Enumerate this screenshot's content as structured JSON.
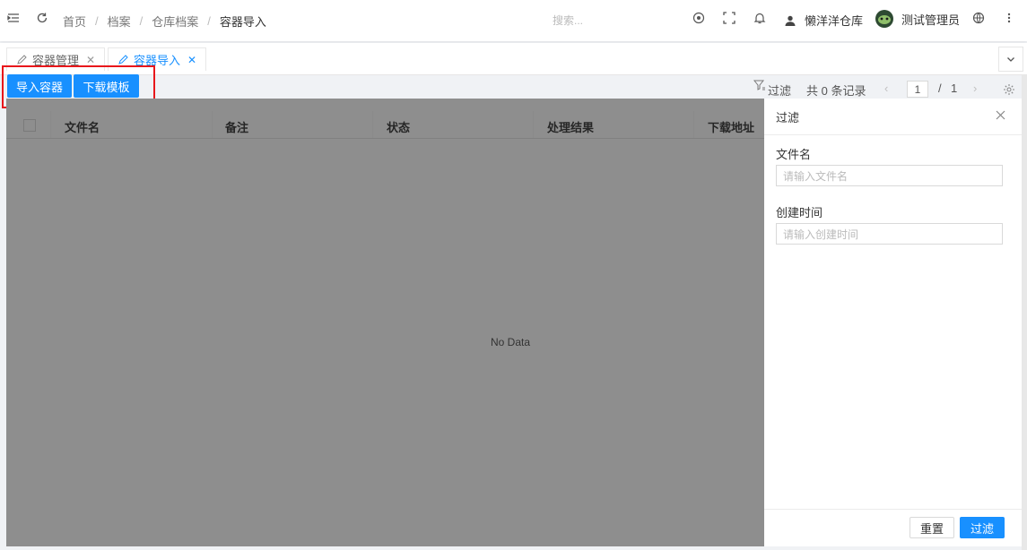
{
  "breadcrumb": [
    "首页",
    "档案",
    "仓库档案",
    "容器导入"
  ],
  "search": {
    "placeholder": "搜索..."
  },
  "header": {
    "warehouse": "懒洋洋仓库",
    "username": "测试管理员"
  },
  "tabs": [
    {
      "label": "容器管理",
      "active": false
    },
    {
      "label": "容器导入",
      "active": true
    }
  ],
  "toolbar": {
    "import_label": "导入容器",
    "download_label": "下载模板",
    "filter_label": "过滤",
    "record_count": "共 0 条记录",
    "page_current": "1",
    "page_sep": "/",
    "page_total": "1"
  },
  "table": {
    "columns": [
      "文件名",
      "备注",
      "状态",
      "处理结果",
      "下载地址"
    ],
    "empty_text": "No Data"
  },
  "drawer": {
    "title": "过滤",
    "fields": [
      {
        "label": "文件名",
        "placeholder": "请输入文件名"
      },
      {
        "label": "创建时间",
        "placeholder": "请输入创建时间"
      }
    ],
    "reset_label": "重置",
    "submit_label": "过滤"
  },
  "colors": {
    "primary": "#1890ff",
    "highlight": "#e8171b",
    "mask": "#8e8e8e"
  }
}
